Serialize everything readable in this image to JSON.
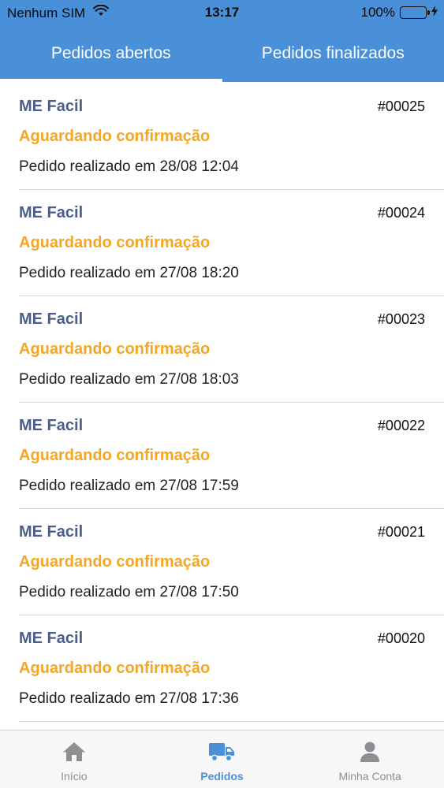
{
  "status_bar": {
    "carrier": "Nenhum SIM",
    "time": "13:17",
    "battery": "100%",
    "battery_level": 1.0
  },
  "tabs": [
    {
      "label": "Pedidos abertos",
      "active": true
    },
    {
      "label": "Pedidos finalizados",
      "active": false
    }
  ],
  "orders": [
    {
      "store": "ME Facil",
      "number": "#00025",
      "status": "Aguardando confirmação",
      "date": "Pedido realizado em 28/08 12:04"
    },
    {
      "store": "ME Facil",
      "number": "#00024",
      "status": "Aguardando confirmação",
      "date": "Pedido realizado em 27/08 18:20"
    },
    {
      "store": "ME Facil",
      "number": "#00023",
      "status": "Aguardando confirmação",
      "date": "Pedido realizado em 27/08 18:03"
    },
    {
      "store": "ME Facil",
      "number": "#00022",
      "status": "Aguardando confirmação",
      "date": "Pedido realizado em 27/08 17:59"
    },
    {
      "store": "ME Facil",
      "number": "#00021",
      "status": "Aguardando confirmação",
      "date": "Pedido realizado em 27/08 17:50"
    },
    {
      "store": "ME Facil",
      "number": "#00020",
      "status": "Aguardando confirmação",
      "date": "Pedido realizado em 27/08 17:36"
    }
  ],
  "bottom_nav": [
    {
      "label": "Início",
      "icon": "home-icon",
      "active": false
    },
    {
      "label": "Pedidos",
      "icon": "truck-icon",
      "active": true
    },
    {
      "label": "Minha Conta",
      "icon": "user-icon",
      "active": false
    }
  ],
  "colors": {
    "primary": "#4a90d9",
    "store_name": "#4a5d8c",
    "status_pending": "#f5a623",
    "nav_inactive": "#8e8e93"
  }
}
